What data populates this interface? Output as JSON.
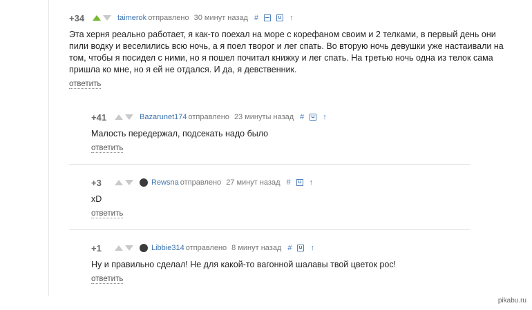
{
  "comments": [
    {
      "rating": "+34",
      "author": "taimerok",
      "sent_label": "отправлено",
      "time": "30 минут назад",
      "text": "Эта херня реально работает, я как-то поехал на море с корефаном своим и 2 телками, в первый день они пили водку и веселились всю ночь, а я поел творог и лег спать. Во вторую ночь девушки уже настаивали на том, чтобы я посидел с ними, но я пошел почитал книжку и лег спать. На третью ночь одна из телок сама пришла ко мне, но я ей не отдался. И да, я девственник.",
      "reply_label": "ответить"
    },
    {
      "rating": "+41",
      "author": "Bazarunet174",
      "sent_label": "отправлено",
      "time": "23 минуты назад",
      "text": "Малость передержал, подсекать надо было",
      "reply_label": "ответить"
    },
    {
      "rating": "+3",
      "author": "Rewsna",
      "sent_label": "отправлено",
      "time": "27 минут назад",
      "text": "xD",
      "reply_label": "ответить"
    },
    {
      "rating": "+1",
      "author": "Libbie314",
      "sent_label": "отправлено",
      "time": "8 минут назад",
      "text": "Ну и правильно сделал! Не для какой-то вагонной шалавы твой цветок рос!",
      "reply_label": "ответить"
    }
  ],
  "tools": {
    "link": "#",
    "up": "↑"
  },
  "watermark": "pikabu.ru",
  "colors": {
    "upvote_active": "#75b72e",
    "link": "#3b73af"
  }
}
